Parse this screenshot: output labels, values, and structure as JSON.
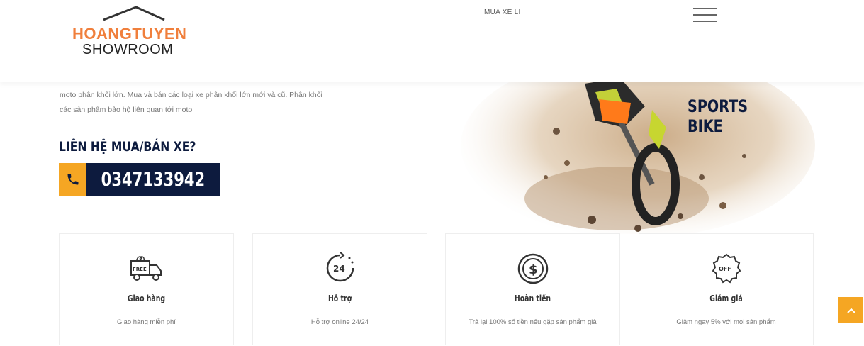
{
  "header": {
    "logo": {
      "line1": "HOANGTUYEN",
      "line2": "SHOWROOM"
    },
    "nav_link": "MUA XE LI",
    "menu_icon": "hamburger-icon"
  },
  "intro": {
    "line1": "moto phân khối lớn. Mua và bán các loại xe phân khối lớn mới và cũ. Phân khối",
    "line2": "các sản phẩm bảo hộ liên quan tới moto"
  },
  "contact": {
    "title": "LIÊN HỆ MUA/BÁN XE?",
    "phone": "0347133942",
    "icon": "phone-icon"
  },
  "hero": {
    "line1": "SPORTS",
    "line2": "BIKE"
  },
  "features": [
    {
      "icon": "free-delivery-truck-icon",
      "title": "Giao hàng",
      "desc": "Giao hàng miễn phí"
    },
    {
      "icon": "support-24-icon",
      "title": "Hỗ trợ",
      "desc": "Hỗ trợ online 24/24"
    },
    {
      "icon": "money-refund-icon",
      "title": "Hoàn tiền",
      "desc": "Trả lại 100% số tiền nếu gặp sản phẩm giả"
    },
    {
      "icon": "discount-off-badge-icon",
      "title": "Giảm giá",
      "desc": "Giảm ngay 5% với mọi sản phẩm"
    }
  ],
  "colors": {
    "accent": "#f5a623",
    "navy": "#0d1b3e",
    "logo_orange": "#f07f3c"
  }
}
